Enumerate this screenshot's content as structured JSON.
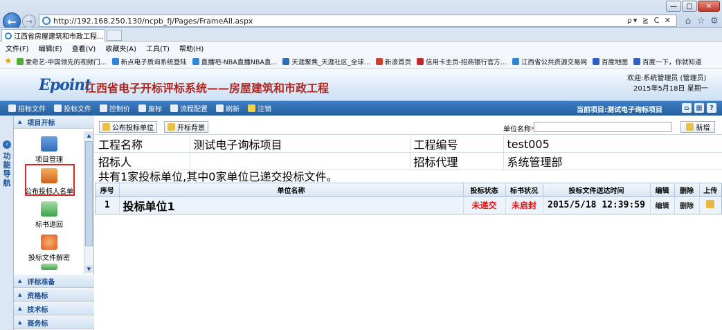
{
  "browser": {
    "url": "http://192.168.250.130/ncpb_fj/Pages/FrameAll.aspx",
    "address_tools": "ρ▾ ≧ C ✕",
    "tab_title": "江西省房屋建筑和市政工程...",
    "tab_close": "×",
    "back": "←",
    "forward": "→",
    "min": "—",
    "max": "□",
    "close": "✕",
    "home": "⌂",
    "favorites": "☆",
    "settings": "⚙"
  },
  "menu": [
    "文件(F)",
    "编辑(E)",
    "查看(V)",
    "收藏夹(A)",
    "工具(T)",
    "帮助(H)"
  ],
  "favorites_bar": [
    {
      "label": "爱奇艺-中国领先的视频门...",
      "color": "#4fae2f"
    },
    {
      "label": "新点电子质询系统登陆",
      "color": "#2f86d8"
    },
    {
      "label": "直播吧-NBA直播NBA直...",
      "color": "#2f86d8"
    },
    {
      "label": "天涯聚焦_天涯社区_全球...",
      "color": "#2f6eb6"
    },
    {
      "label": "新浪首页",
      "color": "#d23d2b"
    },
    {
      "label": "信用卡主页-招商银行官方...",
      "color": "#c0282b"
    },
    {
      "label": "江西省公共资源交易网",
      "color": "#2f86d8"
    },
    {
      "label": "百度地图",
      "color": "#2f5fc5"
    },
    {
      "label": "百度一下，你就知道",
      "color": "#2f5fc5"
    }
  ],
  "header": {
    "logo": "Epoint",
    "title": "江西省电子开标评标系统——房屋建筑和市政工程",
    "welcome": "欢迎:系统管理员 (管理员)",
    "date": "2015年5月18日 星期一"
  },
  "toolbar": {
    "items": [
      "招标文件",
      "投标文件",
      "控制价",
      "废标",
      "流程配置",
      "刷新",
      "注销"
    ],
    "current_project": "当前项目:测试电子询标项目",
    "right_icons": [
      "⌂",
      "▦",
      "?"
    ]
  },
  "sidebar": {
    "strip_label": "功能导航",
    "collapse": "‹",
    "groups": [
      "项目开标",
      "评标准备",
      "资格标",
      "技术标",
      "商务标"
    ],
    "items": [
      {
        "label": "项目管理",
        "color": "#3a7bd5"
      },
      {
        "label": "公布投标人名单",
        "color": "#e07a20"
      },
      {
        "label": "标书退回",
        "color": "#3aa34a"
      },
      {
        "label": "投标文件解密",
        "color": "#e05a20"
      }
    ]
  },
  "actions": {
    "publish": "公布投标单位",
    "background": "开标背景",
    "unit_name_label": "单位名称",
    "required_mark": "*",
    "unit_name_value": "",
    "add": "新增"
  },
  "info": {
    "project_name_label": "工程名称",
    "project_name": "测试电子询标项目",
    "project_no_label": "工程编号",
    "project_no": "test005",
    "tenderee_label": "招标人",
    "tenderee": "",
    "agent_label": "招标代理",
    "agent": "系统管理部",
    "summary": "共有1家投标单位,其中0家单位已递交投标文件。"
  },
  "grid": {
    "headers": [
      "序号",
      "单位名称",
      "投标状态",
      "标书状况",
      "投标文件送达时间",
      "编辑",
      "删除",
      "上传"
    ],
    "rows": [
      {
        "no": "1",
        "name": "投标单位1",
        "status": "未递交",
        "seal": "未启封",
        "time": "2015/5/18 12:39:59",
        "edit": "编辑",
        "delete": "删除"
      }
    ]
  }
}
